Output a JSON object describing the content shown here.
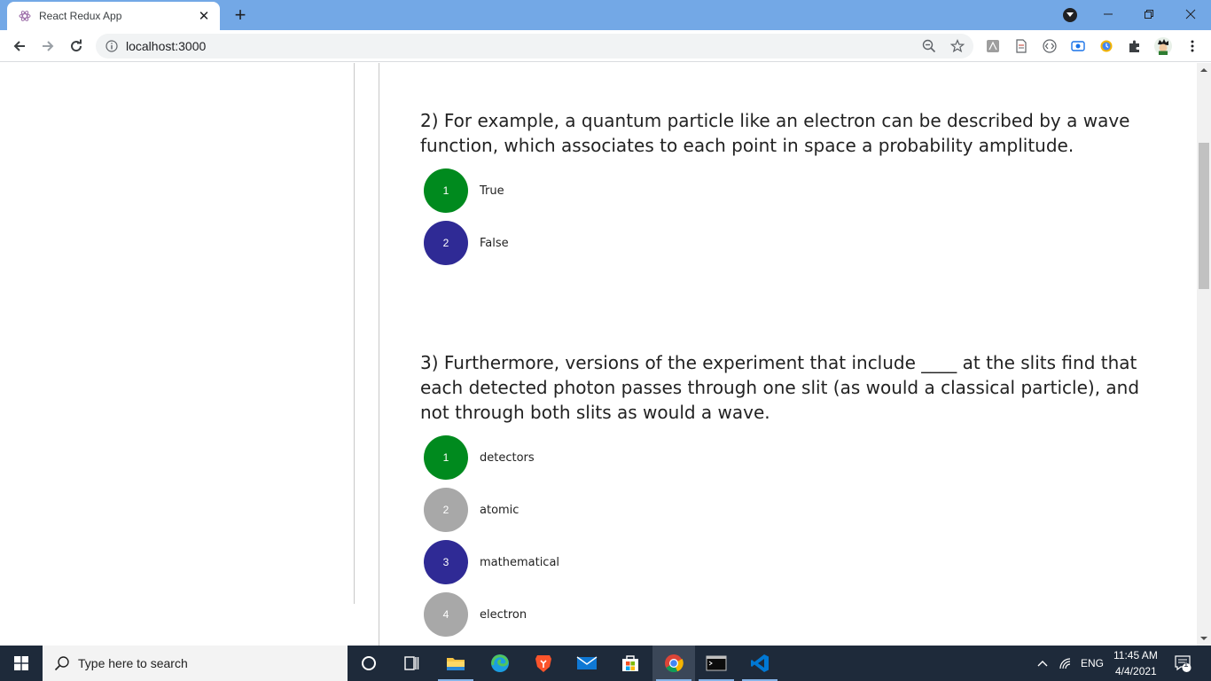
{
  "browser": {
    "tab_title": "React Redux App",
    "url": "localhost:3000"
  },
  "questions": [
    {
      "text": "2) For example, a quantum particle like an electron can be described by a wave function, which associates to each point in space a probability amplitude.",
      "options": [
        {
          "number": "1",
          "label": "True",
          "color": "#008a1e"
        },
        {
          "number": "2",
          "label": "False",
          "color": "#2f2a95"
        }
      ]
    },
    {
      "text": "3) Furthermore, versions of the experiment that include ____ at the slits find that each detected photon passes through one slit (as would a classical particle), and not through both slits as would a wave.",
      "options": [
        {
          "number": "1",
          "label": "detectors",
          "color": "#008a1e"
        },
        {
          "number": "2",
          "label": "atomic",
          "color": "#a8a8a8"
        },
        {
          "number": "3",
          "label": "mathematical",
          "color": "#2f2a95"
        },
        {
          "number": "4",
          "label": "electron",
          "color": "#a8a8a8"
        }
      ]
    }
  ],
  "taskbar": {
    "search_placeholder": "Type here to search",
    "language": "ENG",
    "time": "11:45 AM",
    "date": "4/4/2021",
    "notification_count": "1"
  }
}
